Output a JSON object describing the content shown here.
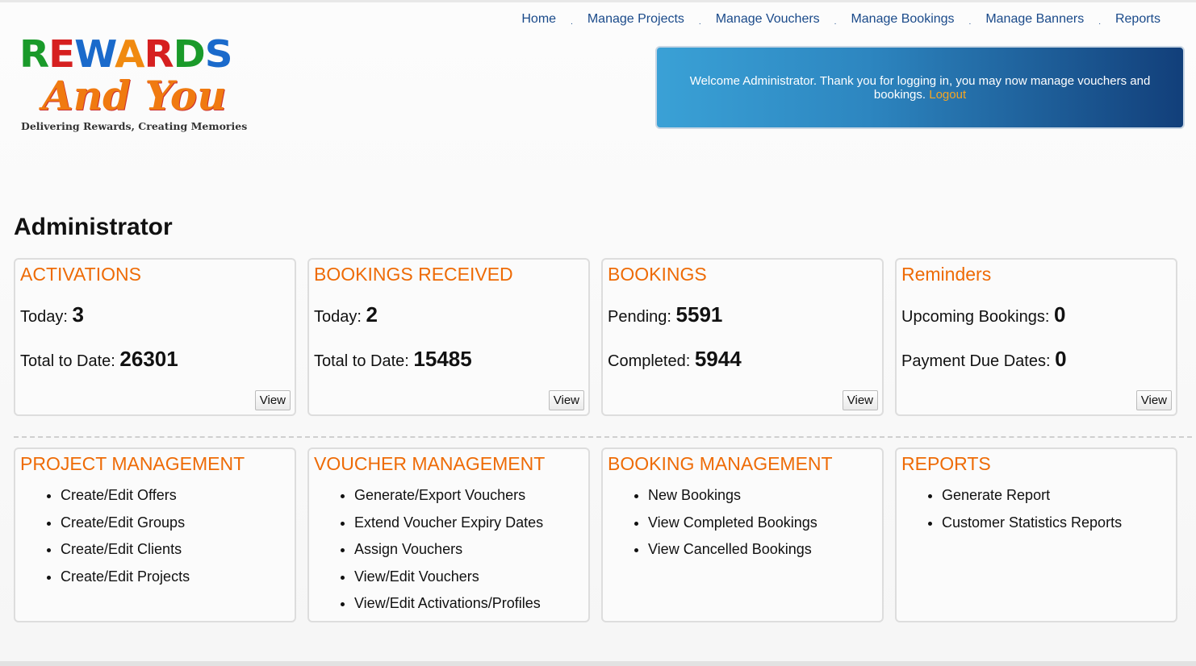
{
  "nav": [
    "Home",
    "Manage Projects",
    "Manage Vouchers",
    "Manage Bookings",
    "Manage Banners",
    "Reports"
  ],
  "nav_separator": ".",
  "logo": {
    "line1": "REWARDS",
    "line2": "And You",
    "tagline": "Delivering Rewards, Creating Memories",
    "line1_colors": [
      "#1a9a2a",
      "#d62020",
      "#1a6acb",
      "#f08a10",
      "#d62020",
      "#1a9a2a",
      "#1a6acb"
    ]
  },
  "welcome": {
    "text": "Welcome Administrator. Thank you for logging in, you may now manage vouchers and bookings.",
    "logout": "Logout"
  },
  "page_title": "Administrator",
  "stat_panels": [
    {
      "title": "ACTIVATIONS",
      "rows": [
        {
          "label": "Today:",
          "value": "3"
        },
        {
          "label": "Total to Date:",
          "value": "26301"
        }
      ],
      "button": "View"
    },
    {
      "title": "BOOKINGS RECEIVED",
      "rows": [
        {
          "label": "Today:",
          "value": "2"
        },
        {
          "label": "Total to Date:",
          "value": "15485"
        }
      ],
      "button": "View"
    },
    {
      "title": "BOOKINGS",
      "rows": [
        {
          "label": "Pending:",
          "value": "5591"
        },
        {
          "label": "Completed:",
          "value": "5944"
        }
      ],
      "button": "View"
    },
    {
      "title": "Reminders",
      "rows": [
        {
          "label": "Upcoming Bookings:",
          "value": "0"
        },
        {
          "label": "Payment Due Dates:",
          "value": "0"
        }
      ],
      "button": "View"
    }
  ],
  "menu_panels": [
    {
      "title": "PROJECT MANAGEMENT",
      "items": [
        "Create/Edit Offers",
        "Create/Edit Groups",
        "Create/Edit Clients",
        "Create/Edit Projects"
      ]
    },
    {
      "title": "VOUCHER MANAGEMENT",
      "items": [
        "Generate/Export Vouchers",
        "Extend Voucher Expiry Dates",
        "Assign Vouchers",
        "View/Edit Vouchers",
        "View/Edit Activations/Profiles"
      ]
    },
    {
      "title": "BOOKING MANAGEMENT",
      "items": [
        "New Bookings",
        "View Completed Bookings",
        "View Cancelled Bookings"
      ]
    },
    {
      "title": "REPORTS",
      "items": [
        "Generate Report",
        "Customer Statistics Reports"
      ]
    }
  ]
}
